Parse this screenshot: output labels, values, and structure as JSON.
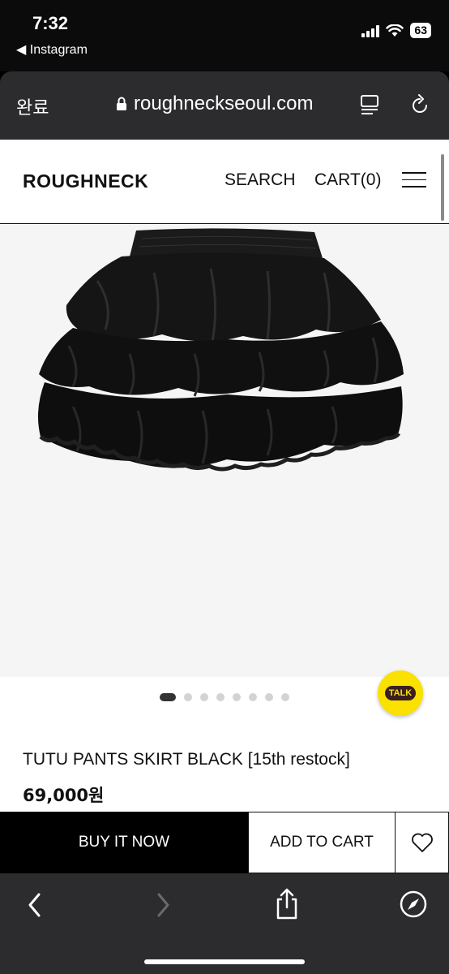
{
  "status_bar": {
    "time": "7:32",
    "back_app": "◀ Instagram",
    "battery": "63"
  },
  "browser": {
    "done_label": "완료",
    "url": "roughneckseoul.com",
    "icons": [
      "lock-icon",
      "reader-icon",
      "reload-icon"
    ]
  },
  "site": {
    "logo": "ROUGHNECK",
    "nav_search": "SEARCH",
    "nav_cart": "CART(0)"
  },
  "product": {
    "image_desc": "black-tiered-tutu-skirt",
    "carousel_count": 8,
    "carousel_active": 0,
    "name": "TUTU PANTS SKIRT BLACK [15th restock]",
    "price": "69,000원"
  },
  "chat_widget": {
    "label": "TALK",
    "color": "#FAE100"
  },
  "actions": {
    "buy_now": "BUY IT NOW",
    "add_to_cart": "ADD TO CART"
  },
  "toolbar": {
    "icons": [
      "back-icon",
      "forward-icon",
      "share-icon",
      "compass-icon"
    ]
  }
}
